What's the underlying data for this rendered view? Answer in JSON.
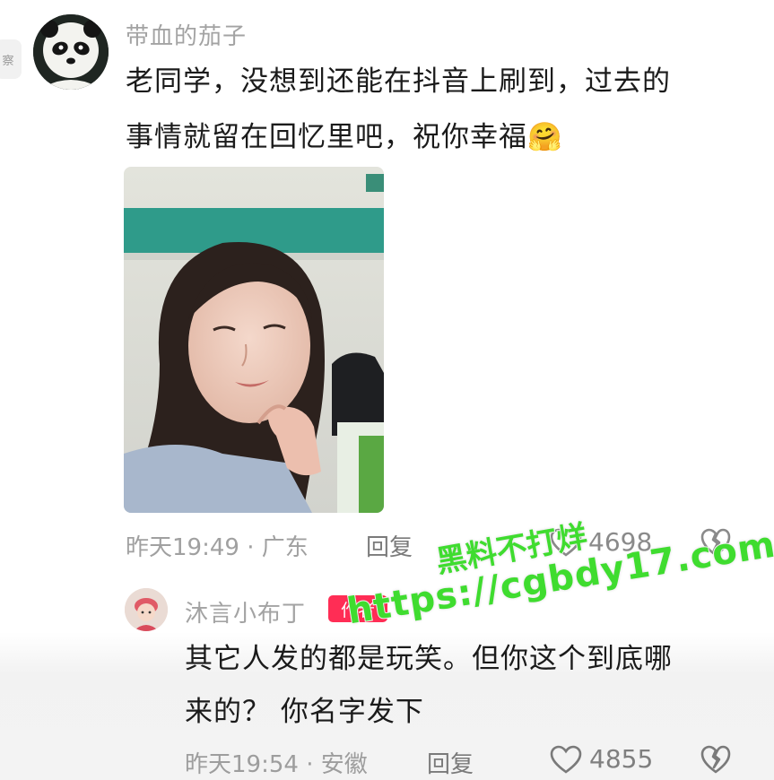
{
  "comment": {
    "user_name": "带血的茄子",
    "text_line1": "老同学，没想到还能在抖音上刷到，过去的",
    "text_line2": "事情就留在回忆里吧，祝你幸福",
    "emoji": "🤗",
    "time": "昨天19:49 · 广东",
    "reply_label": "回复",
    "like_count": "4698"
  },
  "reply_comment": {
    "user_name": "沐言小布丁",
    "author_badge": "作者",
    "text_line1": "其它人发的都是玩笑。但你这个到底哪",
    "text_line2": "来的？ 你名字发下",
    "time": "昨天19:54 · 安徽",
    "reply_label": "回复",
    "like_count": "4855"
  },
  "side_tab_label": "察",
  "watermark": {
    "line1": "黑料不打烊",
    "line2": "https://cgbdy17.com"
  },
  "colors": {
    "author_badge": "#ff2d55",
    "watermark": "#3fdc2f",
    "meta_text": "#a0a0a0"
  }
}
